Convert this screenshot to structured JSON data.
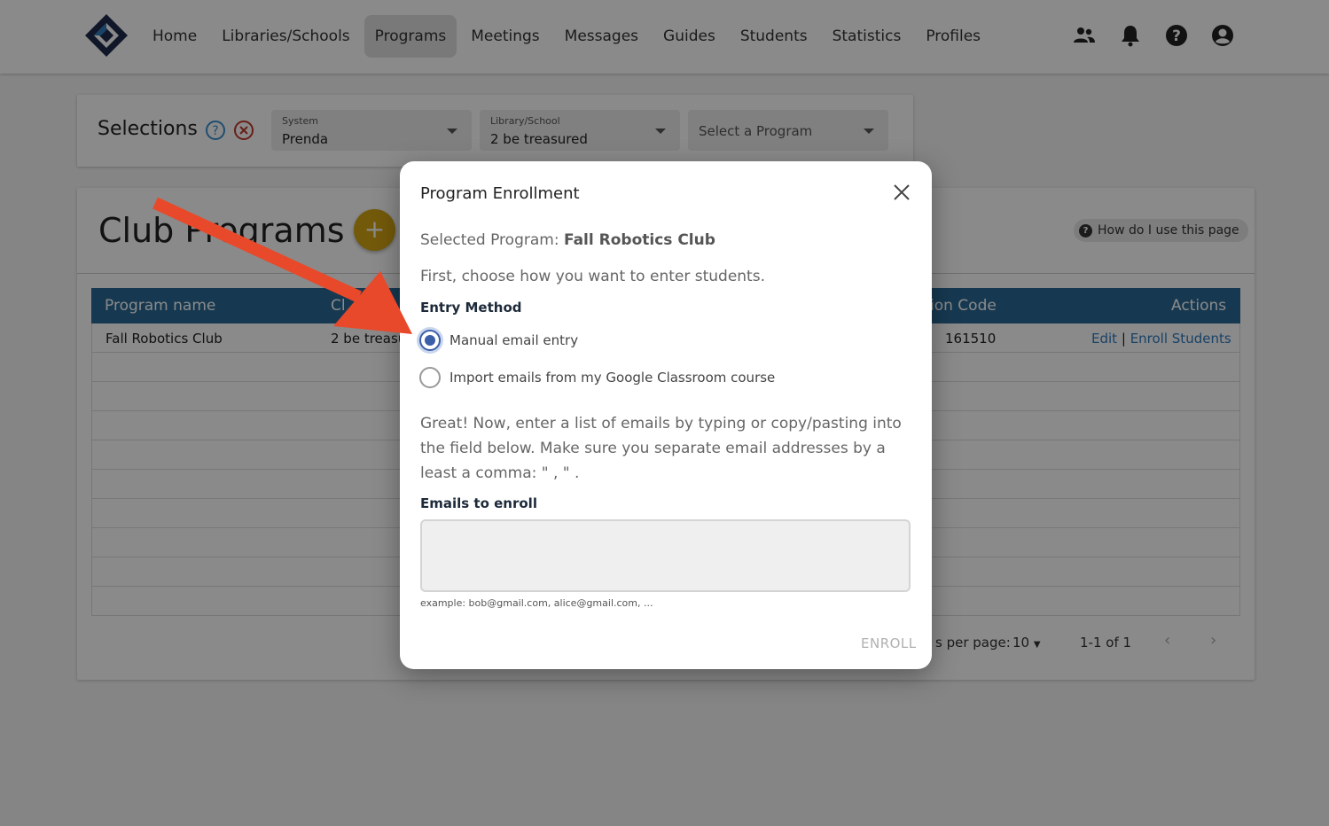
{
  "nav": {
    "items": [
      {
        "label": "Home",
        "active": false
      },
      {
        "label": "Libraries/Schools",
        "active": false
      },
      {
        "label": "Programs",
        "active": true
      },
      {
        "label": "Meetings",
        "active": false
      },
      {
        "label": "Messages",
        "active": false
      },
      {
        "label": "Guides",
        "active": false
      },
      {
        "label": "Students",
        "active": false
      },
      {
        "label": "Statistics",
        "active": false
      },
      {
        "label": "Profiles",
        "active": false
      }
    ],
    "icons": [
      "people-icon",
      "bell-icon",
      "help-icon",
      "account-icon"
    ]
  },
  "selections": {
    "title": "Selections",
    "system": {
      "label": "System",
      "value": "Prenda"
    },
    "library": {
      "label": "Library/School",
      "value": "2 be treasured"
    },
    "program": {
      "placeholder": "Select a Program"
    }
  },
  "club": {
    "title": "Club Programs",
    "add_label": "+",
    "howto": "How do I use this page",
    "columns": [
      "Program name",
      "Cl",
      "ion Code",
      "Actions"
    ],
    "rows": [
      {
        "name": "Fall Robotics Club",
        "library": "2 be treasu",
        "code": "161510",
        "edit": "Edit",
        "sep": "|",
        "enroll": "Enroll Students"
      }
    ],
    "pager": {
      "rows_label": "s per page:",
      "rows_value": "10",
      "range": "1-1 of 1"
    }
  },
  "modal": {
    "title": "Program Enrollment",
    "selected_prefix": "Selected Program: ",
    "selected_program": "Fall Robotics Club",
    "first": "First, choose how you want to enter students.",
    "entry_label": "Entry Method",
    "options": [
      {
        "label": "Manual email entry",
        "selected": true
      },
      {
        "label": "Import emails from my Google Classroom course",
        "selected": false
      }
    ],
    "great": "Great! Now, enter a list of emails by typing or copy/pasting into the field below. Make sure you separate email addresses by a least a comma: \" , \" .",
    "emails_label": "Emails to enroll",
    "emails_value": "",
    "hint": "example: bob@gmail.com, alice@gmail.com, ...",
    "enroll_label": "ENROLL"
  },
  "colors": {
    "accent": "#2a6a96",
    "add_button": "#d4a514",
    "radio": "#3a5ea8",
    "arrow": "#e8492a"
  }
}
